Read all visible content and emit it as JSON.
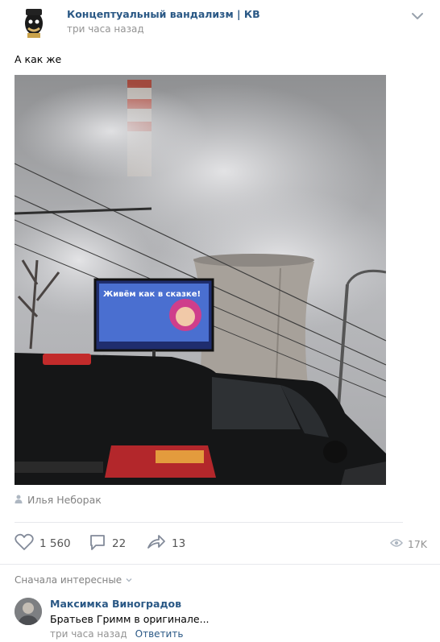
{
  "post": {
    "group_name": "Концептуальный вандализм | КВ",
    "time": "три часа назад",
    "text": "А как же",
    "billboard_text": "Живём как в сказке!",
    "author": "Илья Неборак"
  },
  "actions": {
    "likes": "1 560",
    "comments": "22",
    "shares": "13",
    "views": "17K"
  },
  "comments": {
    "sort_label": "Сначала интересные",
    "items": [
      {
        "author": "Максимка Виноградов",
        "text": "Братьев Гримм в оригинале...",
        "time": "три часа назад",
        "reply_label": "Ответить"
      }
    ]
  },
  "colors": {
    "link": "#2a5885",
    "muted": "#939393",
    "divider": "#e7e8ec"
  },
  "icons": [
    "chevron-down-icon",
    "person-icon",
    "heart-icon",
    "comment-icon",
    "share-icon",
    "eye-icon",
    "small-chevron-icon"
  ]
}
